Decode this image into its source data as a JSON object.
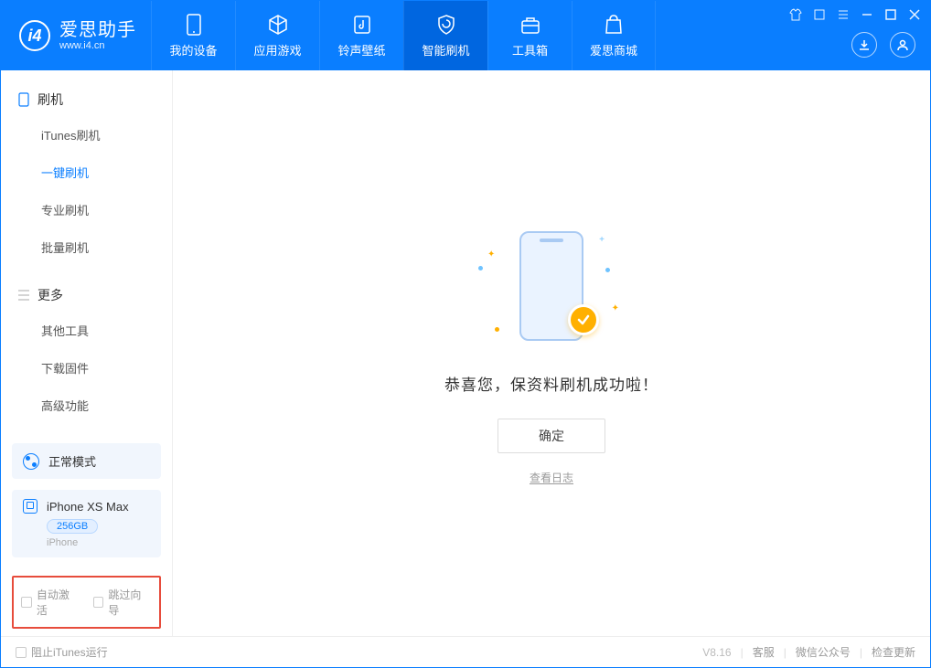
{
  "app": {
    "title": "爱思助手",
    "subtitle": "www.i4.cn"
  },
  "tabs": {
    "device": "我的设备",
    "apps": "应用游戏",
    "ringtones": "铃声壁纸",
    "flash": "智能刷机",
    "toolbox": "工具箱",
    "store": "爱思商城"
  },
  "sidebar": {
    "flash_header": "刷机",
    "itunes_flash": "iTunes刷机",
    "one_click_flash": "一键刷机",
    "pro_flash": "专业刷机",
    "batch_flash": "批量刷机",
    "more_header": "更多",
    "other_tools": "其他工具",
    "download_fw": "下载固件",
    "advanced": "高级功能"
  },
  "mode": {
    "label": "正常模式"
  },
  "device": {
    "name": "iPhone XS Max",
    "storage": "256GB",
    "type": "iPhone"
  },
  "options": {
    "auto_activate": "自动激活",
    "skip_guide": "跳过向导"
  },
  "main": {
    "success_text": "恭喜您，保资料刷机成功啦！",
    "ok_button": "确定",
    "view_log": "查看日志"
  },
  "footer": {
    "block_itunes": "阻止iTunes运行",
    "version": "V8.16",
    "support": "客服",
    "wechat": "微信公众号",
    "update": "检查更新"
  }
}
